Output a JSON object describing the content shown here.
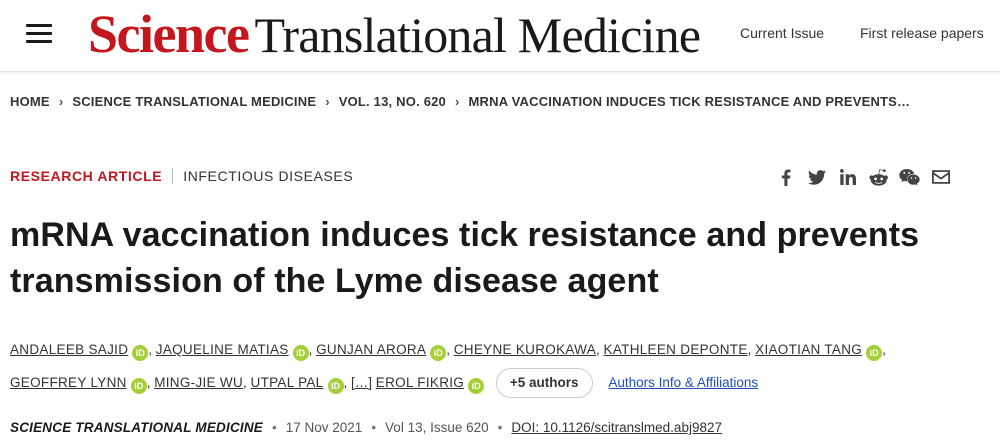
{
  "header": {
    "logo_primary": "Science",
    "logo_secondary": "Translational Medicine",
    "nav": [
      "Current Issue",
      "First release papers"
    ]
  },
  "breadcrumb": [
    "HOME",
    "SCIENCE TRANSLATIONAL MEDICINE",
    "VOL. 13, NO. 620",
    "MRNA VACCINATION INDUCES TICK RESISTANCE AND PREVENTS…"
  ],
  "article": {
    "type": "RESEARCH ARTICLE",
    "subject": "INFECTIOUS DISEASES",
    "title": "mRNA vaccination induces tick resistance and prevents transmission of the Lyme disease agent",
    "orcid_label": "iD",
    "authors": {
      "a1": "ANDALEEB SAJID",
      "a2": "JAQUELINE MATIAS",
      "a3": "GUNJAN ARORA",
      "a4": "CHEYNE KUROKAWA",
      "a5": "KATHLEEN DEPONTE",
      "a6": "XIAOTIAN TANG",
      "a7": "GEOFFREY LYNN",
      "a8": "MING-JIE WU",
      "a9": "UTPAL PAL",
      "a10": "EROL FIKRIG"
    },
    "ellipsis": "[…]",
    "more_authors": "+5 authors",
    "affiliations_link": "Authors Info & Affiliations",
    "journal": "SCIENCE TRANSLATIONAL MEDICINE",
    "date": "17 Nov 2021",
    "volume": "Vol 13, Issue 620",
    "doi": "DOI: 10.1126/scitranslmed.abj9827"
  },
  "share_icons": [
    "facebook-icon",
    "twitter-icon",
    "linkedin-icon",
    "reddit-icon",
    "wechat-icon",
    "email-icon"
  ],
  "colors": {
    "brand_red": "#c4161c",
    "orcid_green": "#a6ce39",
    "link_blue": "#1f4fbd"
  }
}
